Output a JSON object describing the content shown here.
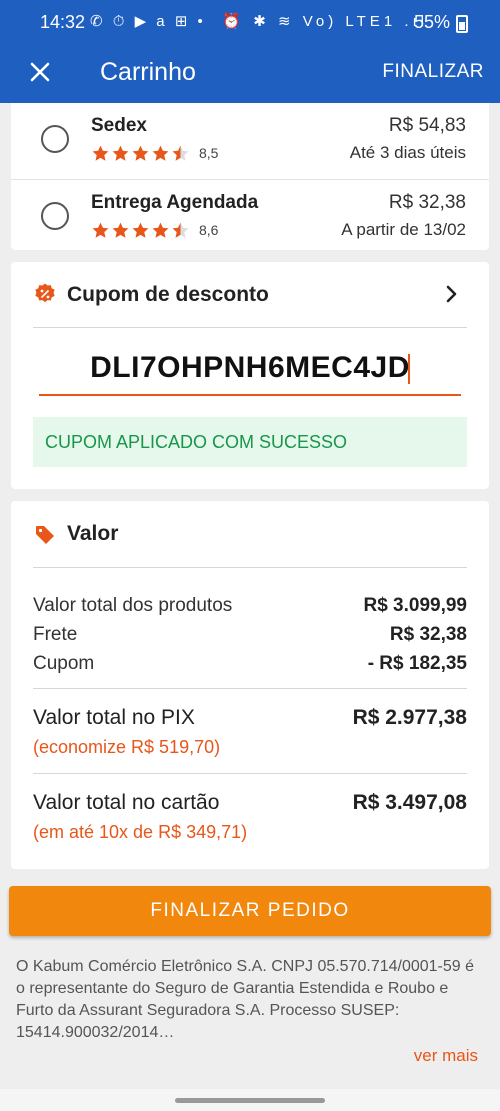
{
  "status_bar": {
    "time": "14:32",
    "left_icons": "✆ ⏱ ▶ a ⊞ •",
    "right_icons": "⏰ ✱ ≋ Vo) LTE1 .ıl",
    "battery": "55%"
  },
  "toolbar": {
    "title": "Carrinho",
    "finalize_label": "FINALIZAR"
  },
  "shipping": {
    "options": [
      {
        "name": "Sedex",
        "rating": "8,5",
        "stars": 4.5,
        "price": "R$ 54,83",
        "eta": "Até 3 dias úteis"
      },
      {
        "name": "Entrega Agendada",
        "rating": "8,6",
        "stars": 4.5,
        "price": "R$ 32,38",
        "eta": "A partir de 13/02"
      }
    ]
  },
  "coupon": {
    "title": "Cupom de desconto",
    "code": "DLI7OHPNH6MEC4JD",
    "success": "CUPOM APLICADO COM SUCESSO"
  },
  "valor": {
    "title": "Valor",
    "rows": [
      {
        "label": "Valor total dos produtos",
        "value": "R$ 3.099,99"
      },
      {
        "label": "Frete",
        "value": "R$ 32,38"
      },
      {
        "label": "Cupom",
        "value": "- R$ 182,35"
      }
    ],
    "pix_label": "Valor total no PIX",
    "pix_value": "R$ 2.977,38",
    "pix_note": "(economize R$ 519,70)",
    "card_label": "Valor total no cartão",
    "card_value": "R$ 3.497,08",
    "card_note": "(em até 10x de R$ 349,71)"
  },
  "cta_label": "FINALIZAR PEDIDO",
  "legal": {
    "text": "O Kabum Comércio Eletrônico S.A. CNPJ 05.570.714/0001-59 é o representante do Seguro de Garantia Estendida e Roubo e Furto da Assurant Seguradora S.A. Processo SUSEP: 15414.900032/2014…",
    "more": "ver mais"
  },
  "colors": {
    "appbar": "#1f5fbf",
    "accent_orange": "#e8561a",
    "cta_orange": "#f2870d",
    "success_green": "#17974a"
  }
}
